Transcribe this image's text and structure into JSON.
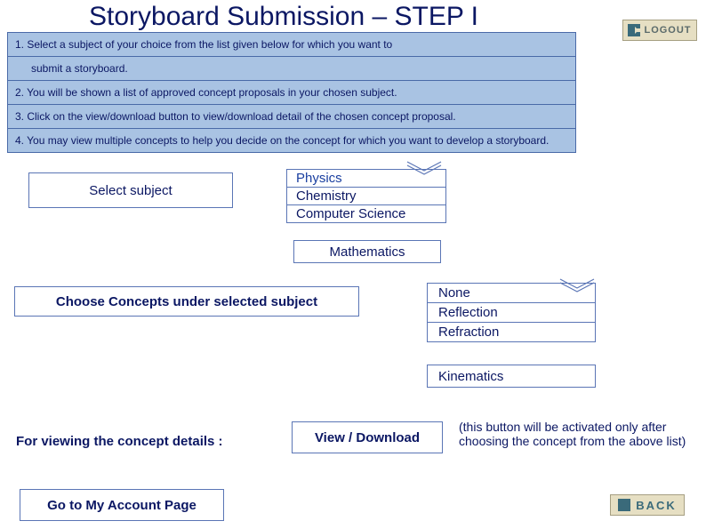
{
  "page": {
    "title": "Storyboard Submission – STEP I"
  },
  "logout": {
    "label": "LOGOUT"
  },
  "instructions": [
    "1. Select a subject of your choice from the list given below for which you want to",
    "submit a storyboard.",
    "2. You will be shown a list of approved concept proposals in your chosen subject.",
    "3. Click on the view/download button to view/download detail of the chosen concept proposal.",
    "4. You may view multiple concepts to help you decide on the concept for which you want to develop a storyboard."
  ],
  "select_subject": {
    "label": "Select  subject"
  },
  "subjects": {
    "items": [
      "Physics",
      "Chemistry",
      "Computer Science"
    ],
    "extra": "Mathematics"
  },
  "choose_concepts": {
    "label": "Choose Concepts under selected subject"
  },
  "concepts": {
    "items": [
      "None",
      "Reflection",
      "Refraction"
    ],
    "extra": "Kinematics"
  },
  "view": {
    "label": "For viewing the concept details :",
    "button": "View / Download",
    "note": "(this button will be activated only after choosing the concept from the above list)"
  },
  "account": {
    "label": "Go to My Account Page"
  },
  "back": {
    "label": "BACK"
  }
}
